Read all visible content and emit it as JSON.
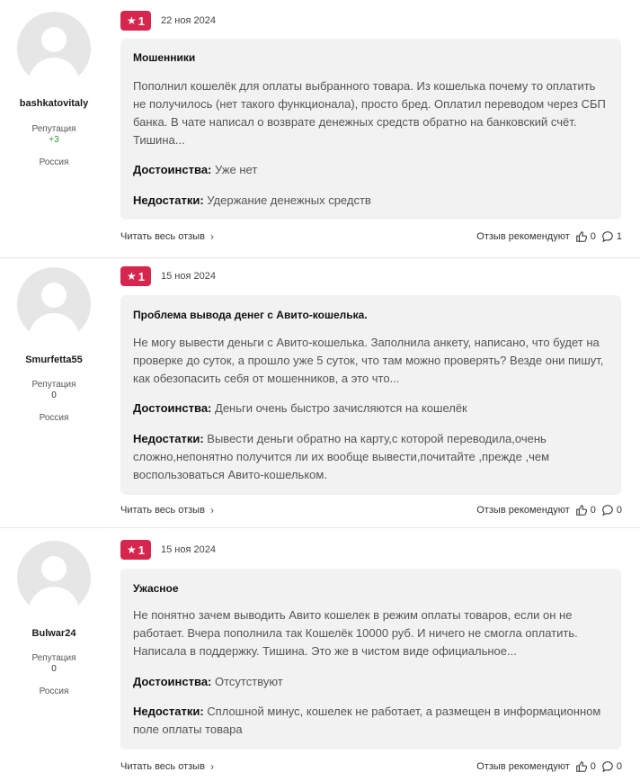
{
  "reviews": [
    {
      "user": {
        "name": "bashkatovitaly",
        "rep_label": "Репутация",
        "rep_value": "+3",
        "country": "Россия"
      },
      "rating": "1",
      "date": "22 ноя 2024",
      "title": "Мошенники",
      "text": "Пополнил кошелёк для оплаты выбранного товара. Из кошелька почему то оплатить не получилось (нет такого функционала), просто бред. Оплатил переводом через СБП банка. В чате написал о возврате денежных средств обратно на банковский счёт. Тишина...",
      "pros_label": "Достоинства:",
      "pros": "Уже нет",
      "cons_label": "Недостатки:",
      "cons": "Удержание денежных средств",
      "read_more": "Читать весь отзыв",
      "recommends": "Отзыв рекомендуют",
      "likes": "0",
      "comments": "1"
    },
    {
      "user": {
        "name": "Smurfetta55",
        "rep_label": "Репутация",
        "rep_value": "0",
        "country": "Россия"
      },
      "rating": "1",
      "date": "15 ноя 2024",
      "title": "Проблема вывода денег с Авито-кошелька.",
      "text": "Не могу вывести деньги с Авито-кошелька. Заполнила анкету, написано, что будет на проверке до суток, а прошло уже 5 суток, что там можно проверять? Везде они пишут, как обезопасить себя от мошенников, а это что...",
      "pros_label": "Достоинства:",
      "pros": "Деньги очень быстро зачисляются на кошелёк",
      "cons_label": "Недостатки:",
      "cons": "Вывести деньги обратно на карту,с которой переводила,очень сложно,непонятно получится ли их вообще вывести,почитайте ,прежде ,чем воспользоваться Авито-кошельком.",
      "read_more": "Читать весь отзыв",
      "recommends": "Отзыв рекомендуют",
      "likes": "0",
      "comments": "0"
    },
    {
      "user": {
        "name": "Bulwar24",
        "rep_label": "Репутация",
        "rep_value": "0",
        "country": "Россия"
      },
      "rating": "1",
      "date": "15 ноя 2024",
      "title": "Ужасное",
      "text": "Не понятно зачем выводить Авито кошелек в режим оплаты товаров, если он не работает. Вчера пополнила так Кошелёк 10000 руб. И ничего не смогла оплатить. Написала в поддержку. Тишина. Это же в чистом виде официальное...",
      "pros_label": "Достоинства:",
      "pros": "Отсутствуют",
      "cons_label": "Недостатки:",
      "cons": "Сплошной минус, кошелек не работает, а размещен в информационном поле оплаты товара",
      "read_more": "Читать весь отзыв",
      "recommends": "Отзыв рекомендуют",
      "likes": "0",
      "comments": "0"
    }
  ],
  "icons": {
    "rating": "star-icon",
    "like": "thumbs-up-icon",
    "comment": "comment-icon",
    "more": "chevron-right-icon"
  },
  "colors": {
    "badge": "#d7264e",
    "card": "#f2f2f2",
    "positive_rep": "#2a9d2a"
  }
}
